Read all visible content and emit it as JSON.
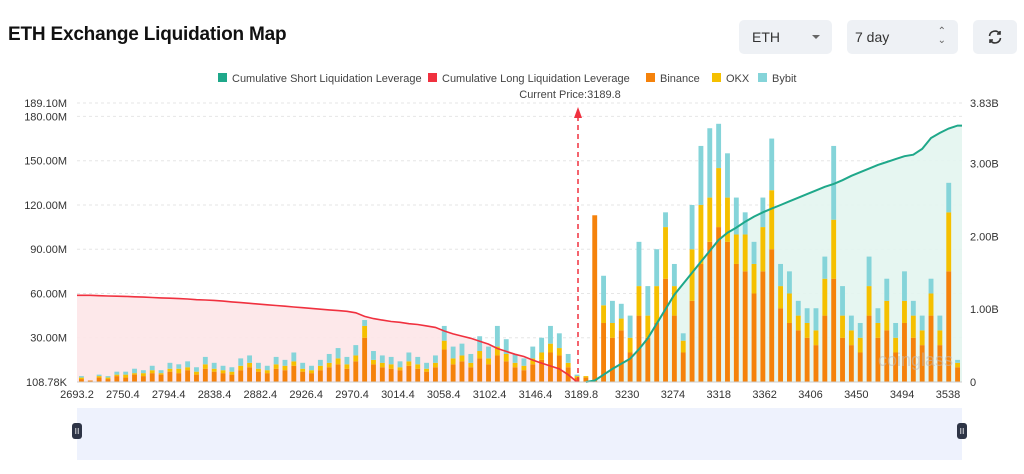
{
  "header": {
    "title": "ETH Exchange Liquidation Map",
    "symbol_select": "ETH",
    "period_select": "7 day",
    "refresh_icon": "refresh-icon"
  },
  "watermark": "coinglass",
  "chart_data": {
    "type": "bar",
    "title": "",
    "legend_position": "top-center",
    "legend": [
      {
        "name": "Cumulative Short Liquidation Leverage",
        "color": "#1fa88a"
      },
      {
        "name": "Cumulative Long Liquidation Leverage",
        "color": "#f0313f"
      },
      {
        "name": "Binance",
        "color": "#f5820b"
      },
      {
        "name": "OKX",
        "color": "#f5c000"
      },
      {
        "name": "Bybit",
        "color": "#85d4d9"
      }
    ],
    "current_price_label": "Current Price:3189.8",
    "current_price": 3189.8,
    "x_tick_labels": [
      "2693.2",
      "2750.4",
      "2794.4",
      "2838.4",
      "2882.4",
      "2926.4",
      "2970.4",
      "3014.4",
      "3058.4",
      "3102.4",
      "3146.4",
      "3189.8",
      "3230",
      "3274",
      "3318",
      "3362",
      "3406",
      "3450",
      "3494",
      "3538"
    ],
    "y_left": {
      "ticks": [
        "108.78K",
        "30.00M",
        "60.00M",
        "90.00M",
        "120.00M",
        "150.00M",
        "180.00M",
        "189.10M"
      ],
      "range_m": [
        0,
        189.1
      ]
    },
    "y_right": {
      "ticks": [
        "0",
        "1.00B",
        "2.00B",
        "3.00B",
        "3.83B"
      ],
      "range_b": [
        0,
        3.83
      ]
    },
    "grid": true,
    "bars_unit": "M",
    "series": [
      {
        "name": "Binance",
        "values": [
          2,
          1,
          3,
          2,
          4,
          3,
          5,
          4,
          6,
          5,
          7,
          6,
          8,
          5,
          9,
          7,
          6,
          5,
          8,
          10,
          7,
          6,
          9,
          8,
          11,
          7,
          6,
          8,
          10,
          12,
          9,
          14,
          30,
          12,
          10,
          9,
          8,
          11,
          9,
          7,
          10,
          22,
          12,
          14,
          10,
          16,
          12,
          18,
          14,
          10,
          8,
          12,
          15,
          20,
          18,
          10,
          3,
          3,
          113,
          40,
          30,
          35,
          20,
          45,
          30,
          40,
          70,
          45,
          20,
          55,
          80,
          95,
          105,
          95,
          80,
          75,
          60,
          75,
          90,
          50,
          40,
          35,
          30,
          25,
          45,
          70,
          30,
          25,
          20,
          45,
          30,
          35,
          20,
          40,
          30,
          25,
          45,
          25,
          75,
          10
        ]
      },
      {
        "name": "OKX",
        "values": [
          1,
          0,
          1,
          1,
          1,
          2,
          1,
          2,
          2,
          1,
          2,
          3,
          2,
          2,
          3,
          2,
          2,
          2,
          3,
          3,
          2,
          2,
          3,
          3,
          3,
          2,
          2,
          3,
          3,
          4,
          3,
          4,
          8,
          3,
          3,
          3,
          2,
          3,
          3,
          2,
          3,
          6,
          4,
          4,
          3,
          5,
          4,
          6,
          5,
          3,
          3,
          4,
          5,
          6,
          5,
          3,
          1,
          1,
          0,
          12,
          10,
          8,
          10,
          20,
          15,
          25,
          35,
          20,
          8,
          35,
          40,
          30,
          40,
          30,
          20,
          25,
          20,
          30,
          40,
          15,
          20,
          10,
          10,
          10,
          25,
          40,
          15,
          10,
          10,
          20,
          10,
          20,
          10,
          15,
          15,
          10,
          15,
          10,
          40,
          3
        ]
      },
      {
        "name": "Bybit",
        "values": [
          1,
          0,
          1,
          1,
          2,
          2,
          3,
          2,
          3,
          2,
          4,
          3,
          4,
          3,
          5,
          4,
          3,
          3,
          5,
          5,
          4,
          3,
          5,
          4,
          6,
          4,
          3,
          4,
          6,
          7,
          5,
          7,
          4,
          6,
          5,
          5,
          4,
          6,
          5,
          4,
          5,
          10,
          8,
          8,
          6,
          10,
          8,
          14,
          10,
          6,
          5,
          8,
          10,
          12,
          10,
          6,
          1,
          0,
          0,
          20,
          15,
          10,
          15,
          30,
          20,
          25,
          10,
          15,
          5,
          30,
          40,
          47,
          30,
          30,
          25,
          15,
          15,
          20,
          35,
          15,
          15,
          10,
          10,
          15,
          15,
          50,
          20,
          10,
          10,
          20,
          10,
          15,
          10,
          20,
          10,
          10,
          10,
          10,
          20,
          2
        ]
      }
    ],
    "lines_unit": "B",
    "cumulative_long": [
      1.19,
      1.19,
      1.185,
      1.18,
      1.178,
      1.175,
      1.17,
      1.165,
      1.16,
      1.155,
      1.15,
      1.145,
      1.14,
      1.13,
      1.125,
      1.12,
      1.11,
      1.1,
      1.09,
      1.08,
      1.07,
      1.06,
      1.05,
      1.04,
      1.03,
      1.02,
      1.01,
      1.0,
      0.99,
      0.98,
      0.97,
      0.95,
      0.9,
      0.87,
      0.85,
      0.83,
      0.82,
      0.8,
      0.79,
      0.77,
      0.75,
      0.7,
      0.66,
      0.63,
      0.6,
      0.56,
      0.52,
      0.46,
      0.42,
      0.38,
      0.35,
      0.3,
      0.26,
      0.22,
      0.18,
      0.1,
      0.0
    ],
    "cumulative_short": [
      0,
      0.02,
      0.1,
      0.18,
      0.25,
      0.32,
      0.45,
      0.6,
      0.8,
      1.0,
      1.2,
      1.35,
      1.5,
      1.65,
      1.8,
      1.95,
      2.05,
      2.12,
      2.2,
      2.27,
      2.33,
      2.38,
      2.43,
      2.48,
      2.53,
      2.58,
      2.63,
      2.68,
      2.72,
      2.77,
      2.83,
      2.88,
      2.93,
      2.98,
      3.02,
      3.06,
      3.1,
      3.12,
      3.2,
      3.35,
      3.42,
      3.48,
      3.52
    ]
  }
}
